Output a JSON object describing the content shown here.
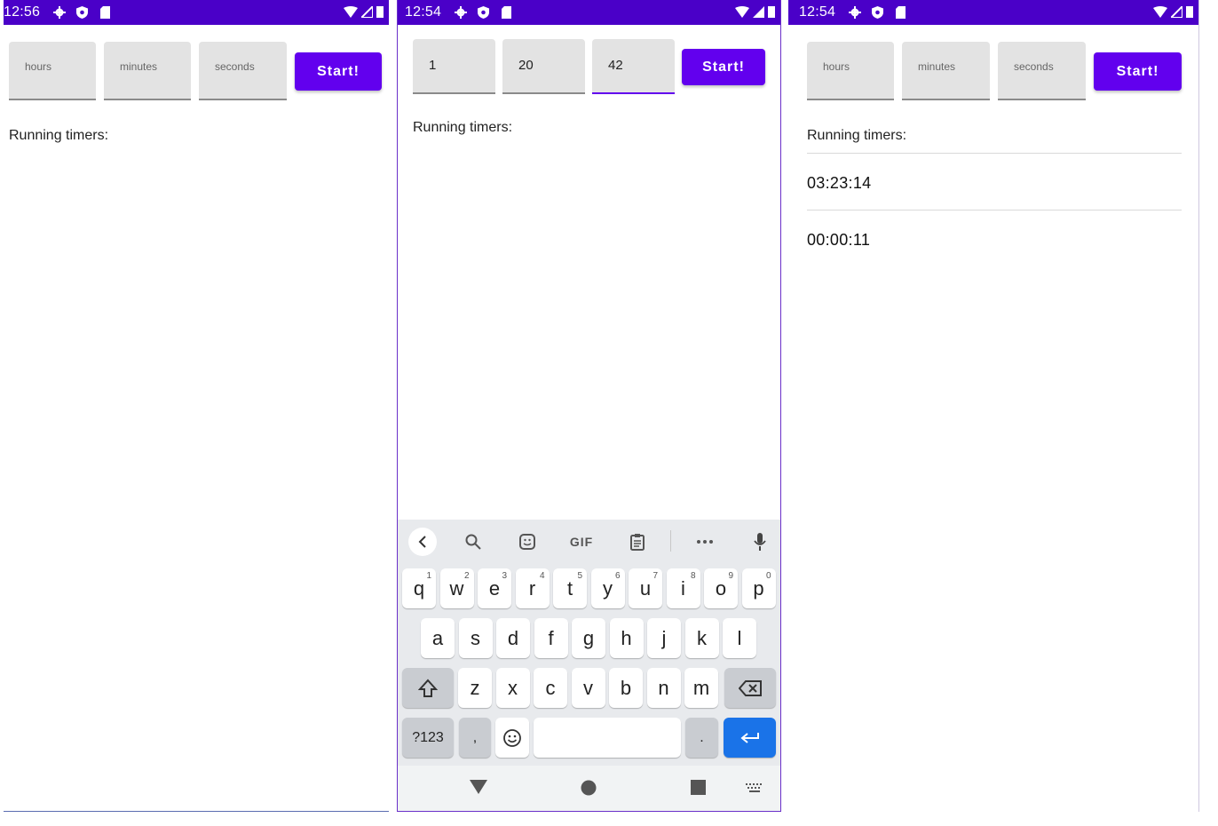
{
  "colors": {
    "status_bar": "#4a00c8",
    "accent": "#6200ee",
    "enter_key": "#1a73e8"
  },
  "panels": [
    {
      "status": {
        "time": "12:56"
      },
      "fields": [
        {
          "placeholder": "hours",
          "value": ""
        },
        {
          "placeholder": "minutes",
          "value": ""
        },
        {
          "placeholder": "seconds",
          "value": ""
        }
      ],
      "start_label": "Start!",
      "running_label": "Running timers:",
      "timers": []
    },
    {
      "status": {
        "time": "12:54"
      },
      "fields": [
        {
          "placeholder": "hours",
          "value": "1"
        },
        {
          "placeholder": "minutes",
          "value": "20"
        },
        {
          "placeholder": "seconds",
          "value": "42",
          "focused": true
        }
      ],
      "start_label": "Start!",
      "running_label": "Running timers:",
      "timers": []
    },
    {
      "status": {
        "time": "12:54"
      },
      "fields": [
        {
          "placeholder": "hours",
          "value": ""
        },
        {
          "placeholder": "minutes",
          "value": ""
        },
        {
          "placeholder": "seconds",
          "value": ""
        }
      ],
      "start_label": "Start!",
      "running_label": "Running timers:",
      "timers": [
        "03:23:14",
        "00:00:11"
      ]
    }
  ],
  "keyboard": {
    "toolbar": [
      "back-icon",
      "search-icon",
      "sticker-icon",
      "GIF",
      "clipboard-icon",
      "more-icon",
      "mic-icon"
    ],
    "gif_label": "GIF",
    "row1": [
      "q",
      "w",
      "e",
      "r",
      "t",
      "y",
      "u",
      "i",
      "o",
      "p"
    ],
    "row1_hints": [
      "1",
      "2",
      "3",
      "4",
      "5",
      "6",
      "7",
      "8",
      "9",
      "0"
    ],
    "row2": [
      "a",
      "s",
      "d",
      "f",
      "g",
      "h",
      "j",
      "k",
      "l"
    ],
    "row3": [
      "z",
      "x",
      "c",
      "v",
      "b",
      "n",
      "m"
    ],
    "symbols_label": "?123",
    "comma_label": ",",
    "period_label": "."
  }
}
